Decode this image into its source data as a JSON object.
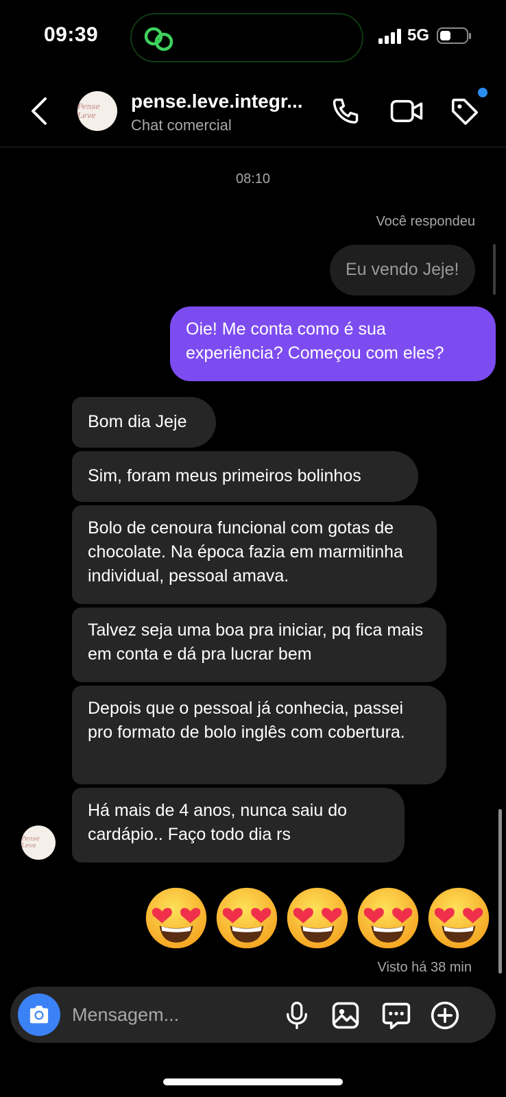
{
  "status_bar": {
    "time": "09:39",
    "network": "5G"
  },
  "header": {
    "name": "pense.leve.integr...",
    "subtitle": "Chat comercial",
    "avatar_text": "Pense Leve"
  },
  "conversation": {
    "timestamp": "08:10",
    "reply_label": "Você respondeu",
    "replied_message": "Eu vendo Jeje!",
    "sent_message": "Oie! Me conta como é sua experiência? Começou com eles?",
    "received": [
      "Bom dia Jeje",
      "Sim, foram meus primeiros bolinhos",
      "Bolo de cenoura funcional com gotas de chocolate. Na época fazia em marmitinha individual, pessoal amava.",
      "Talvez seja uma boa pra iniciar, pq fica mais em conta e dá pra lucrar bem",
      "Depois que o pessoal já conhecia, passei pro formato de bolo inglês com cobertura.",
      "Há mais de 4 anos, nunca saiu do cardápio.. Faço todo dia rs"
    ],
    "emoji_reaction": [
      "heart-eyes",
      "heart-eyes",
      "heart-eyes",
      "heart-eyes",
      "heart-eyes"
    ],
    "seen_status": "Visto há 38 min"
  },
  "composer": {
    "placeholder": "Mensagem..."
  },
  "icons": {
    "back": "chevron-left-icon",
    "call": "phone-icon",
    "video": "video-icon",
    "tag": "tag-icon",
    "camera": "camera-icon",
    "mic": "mic-icon",
    "gallery": "gallery-icon",
    "sticker": "chat-bubble-icon",
    "add": "plus-circle-icon"
  },
  "colors": {
    "accent": "#7d4cf1",
    "camera_button": "#3b82f6",
    "notification_dot": "#2a8cf0",
    "bubble_received": "#262626"
  }
}
